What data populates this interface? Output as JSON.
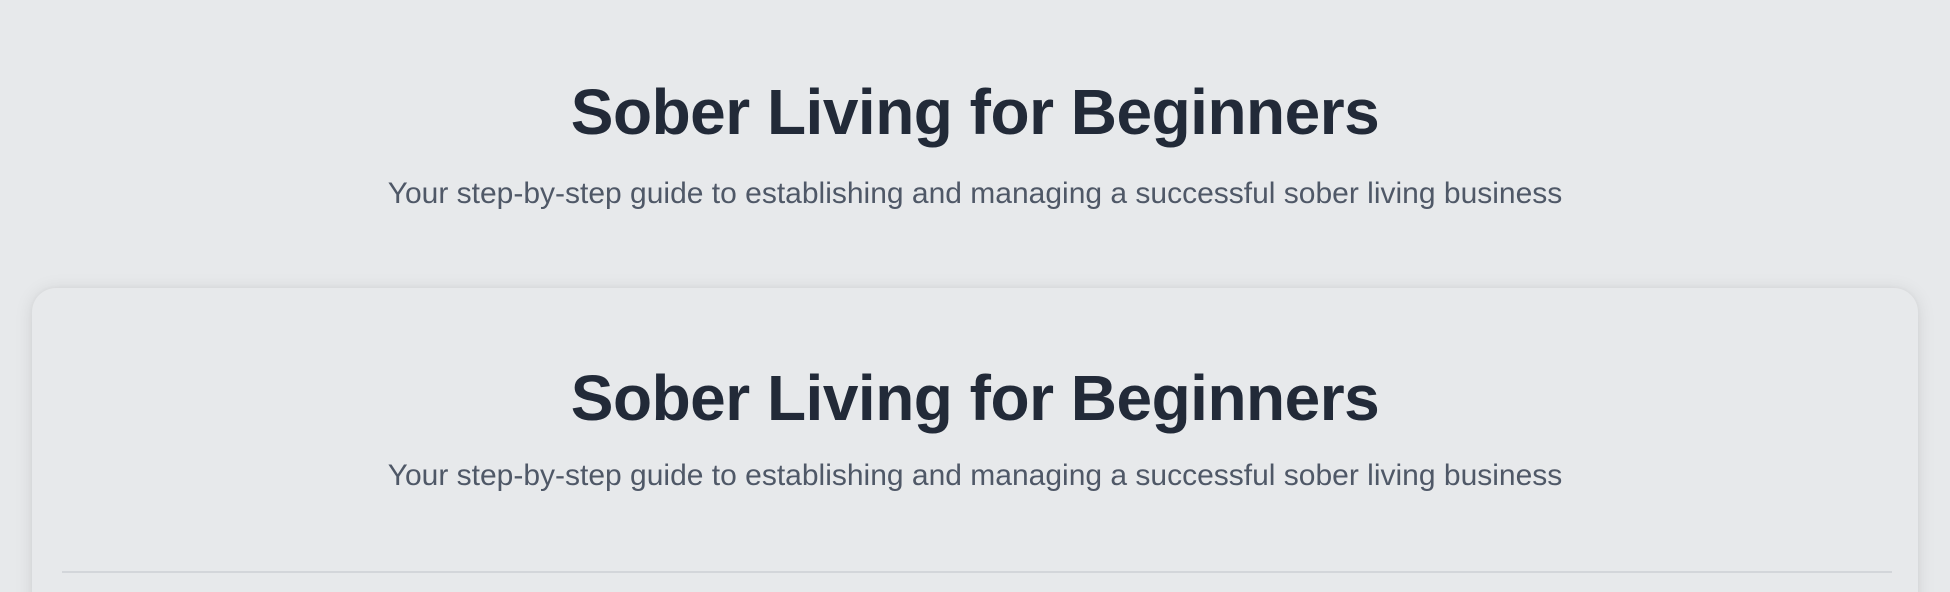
{
  "header": {
    "title": "Sober Living for Beginners",
    "subtitle": "Your step-by-step guide to establishing and managing a successful sober living business"
  },
  "card": {
    "title": "Sober Living for Beginners",
    "subtitle": "Your step-by-step guide to establishing and managing a successful sober living business"
  },
  "colors": {
    "background": "#e7e9eb",
    "title_text": "#222a38",
    "subtitle_text": "#4f5867",
    "divider": "#d3d6da"
  }
}
